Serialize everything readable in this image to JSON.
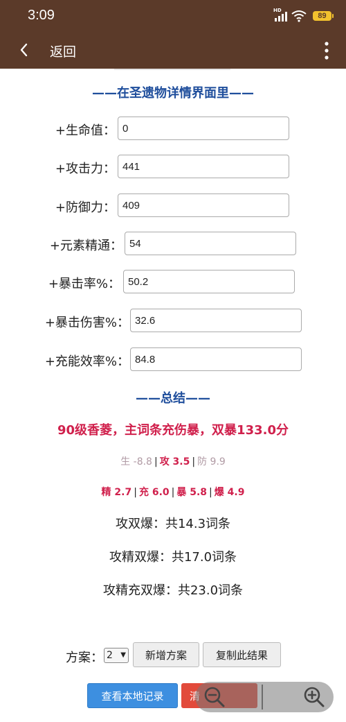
{
  "status": {
    "time": "3:09",
    "battery": "89",
    "hd": "HD"
  },
  "appbar": {
    "back_label": "返回"
  },
  "section_title": "——在圣遗物详情界面里——",
  "fields": [
    {
      "label": "+生命值：",
      "value": "0"
    },
    {
      "label": "+攻击力：",
      "value": "441"
    },
    {
      "label": "+防御力：",
      "value": "409"
    },
    {
      "label": "+元素精通：",
      "value": "54"
    },
    {
      "label": "+暴击率%：",
      "value": "50.2"
    },
    {
      "label": "+暴击伤害%：",
      "value": "32.6"
    },
    {
      "label": "+充能效率%：",
      "value": "84.8"
    }
  ],
  "summary": {
    "title": "——总结——",
    "main": "90级香菱，主词条充伤暴，双暴133.0分",
    "scores1": {
      "hp": "生 -8.8",
      "atk": "攻 3.5",
      "def": "防 9.9"
    },
    "scores2": {
      "em": "精 2.7",
      "er": "充 6.0",
      "cr": "暴 5.8",
      "cd": "爆 4.9"
    },
    "sep": "|",
    "line1": "攻双爆：共14.3词条",
    "line2": "攻精双爆：共17.0词条",
    "line3": "攻精充双爆：共23.0词条"
  },
  "plan": {
    "label": "方案：",
    "selected": "2",
    "add_label": "新增方案",
    "copy_label": "复制此结果"
  },
  "bottom": {
    "local_records_label": "查看本地记录",
    "red_button_label": "清"
  },
  "colors": {
    "header_bg": "#5b3a29",
    "title_blue": "#1f4e9c",
    "accent_red": "#d0204c"
  }
}
